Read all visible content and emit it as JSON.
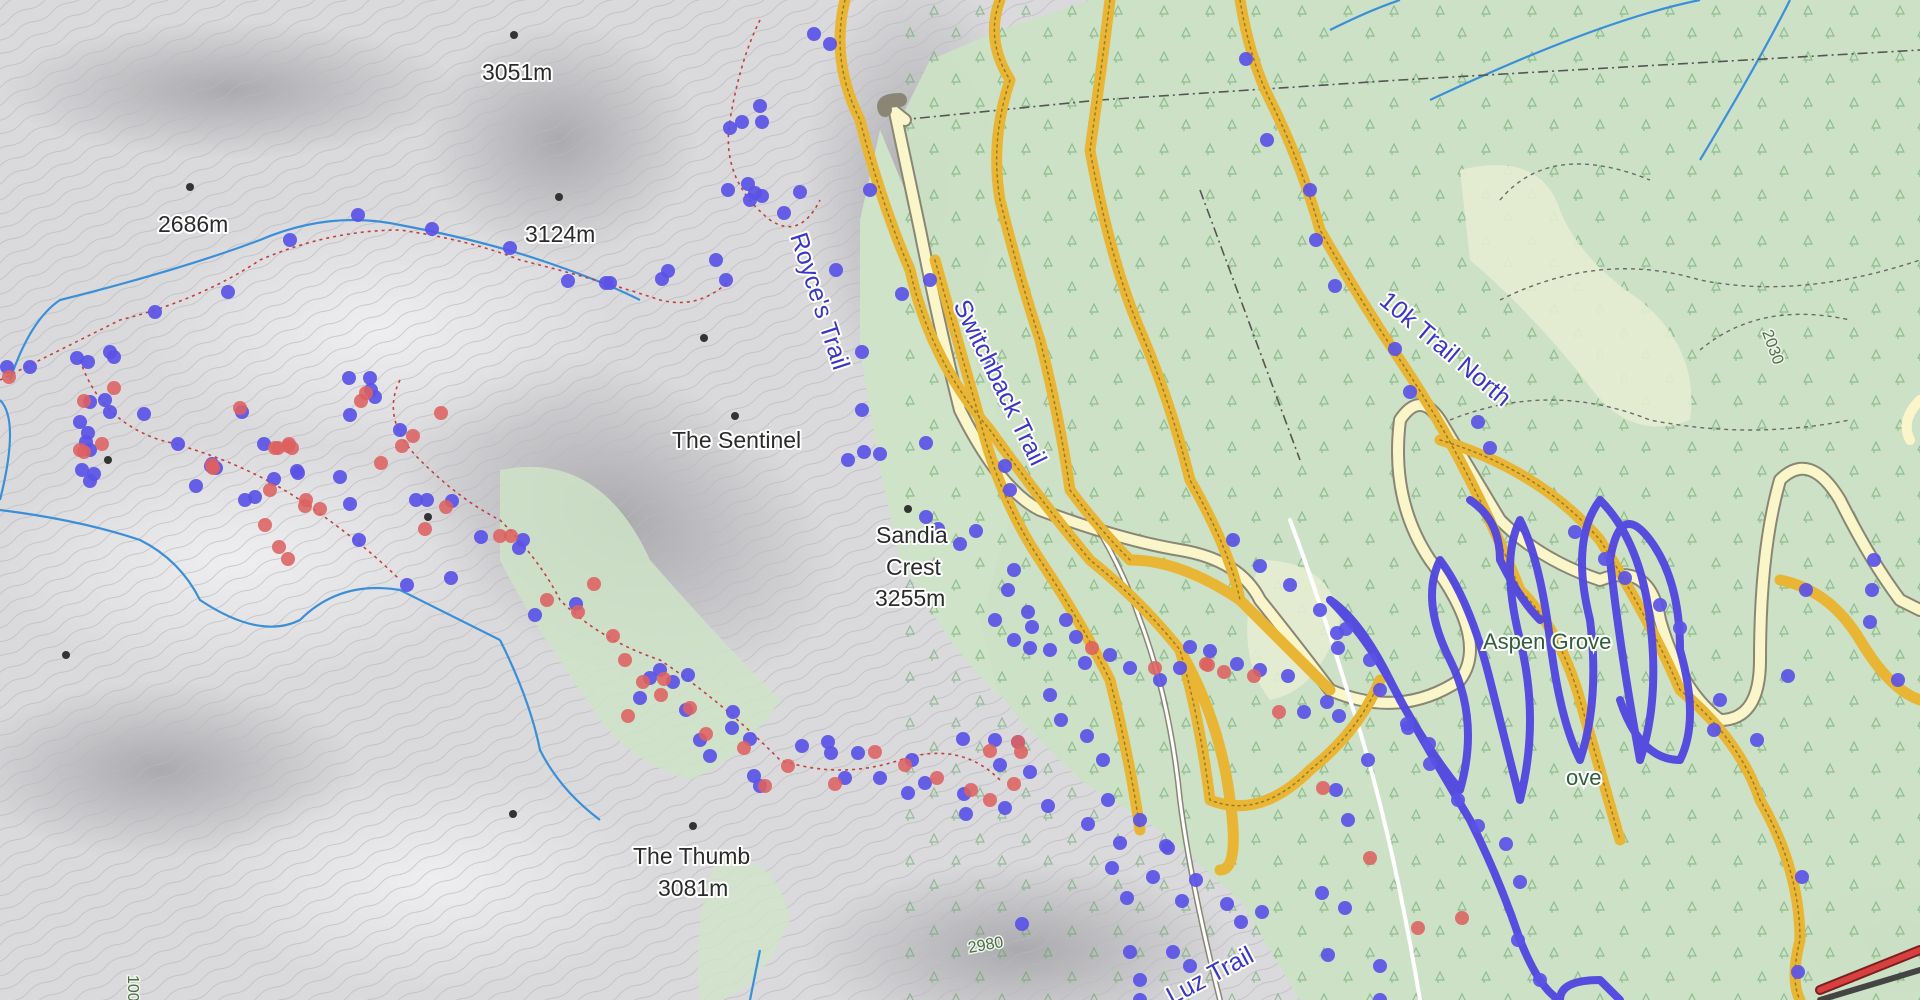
{
  "map": {
    "peaks": [
      {
        "name": "3051m"
      },
      {
        "name": "2686m"
      },
      {
        "name": "3124m"
      },
      {
        "name": "The Sentinel"
      },
      {
        "name": "Sandia"
      },
      {
        "name": "Crest"
      },
      {
        "name": "3255m"
      },
      {
        "name": "The Thumb"
      },
      {
        "name": "3081m"
      },
      {
        "name": "Aspen Grove"
      },
      {
        "name": "ove"
      }
    ],
    "trails": [
      {
        "name": "Royce's Trail"
      },
      {
        "name": "Switchback Trail"
      },
      {
        "name": "10k Trail North"
      },
      {
        "name": "Luz Trail"
      }
    ],
    "contour_labels": [
      "2030",
      "2980",
      "100"
    ],
    "colors": {
      "terrain": "#d9d9dc",
      "forest": "#cfe3c8",
      "trail_gold": "#e8b634",
      "route_blue": "#5046e0",
      "route_red": "#d9534f",
      "road": "#fbf6c9",
      "stream": "#3b8fd9"
    }
  }
}
